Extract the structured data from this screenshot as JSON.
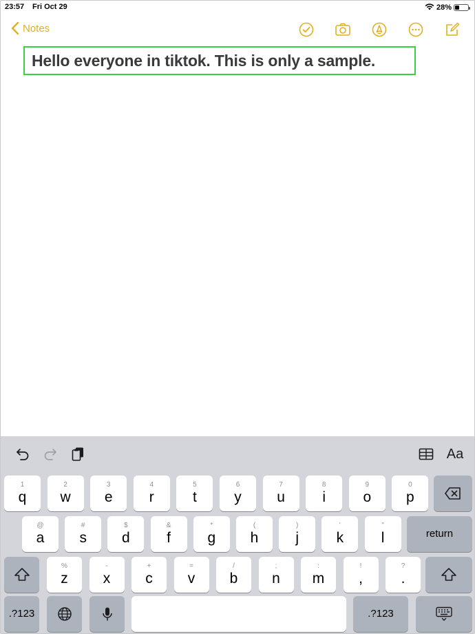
{
  "status_bar": {
    "time": "23:57",
    "date": "Fri Oct 29",
    "battery_text": "28%",
    "battery_level": 0.28
  },
  "nav": {
    "back_label": "Notes",
    "icons": [
      "checklist-icon",
      "camera-icon",
      "markup-icon",
      "more-icon",
      "compose-icon"
    ],
    "accent_color": "#e0b020"
  },
  "note": {
    "text": "Hello everyone in tiktok. This is only a sample.",
    "highlight_color": "#3bd146"
  },
  "keyboard": {
    "toolbar": {
      "format_label": "Aa"
    },
    "row1": [
      {
        "sub": "1",
        "main": "q"
      },
      {
        "sub": "2",
        "main": "w"
      },
      {
        "sub": "3",
        "main": "e"
      },
      {
        "sub": "4",
        "main": "r"
      },
      {
        "sub": "5",
        "main": "t"
      },
      {
        "sub": "6",
        "main": "y"
      },
      {
        "sub": "7",
        "main": "u"
      },
      {
        "sub": "8",
        "main": "i"
      },
      {
        "sub": "9",
        "main": "o"
      },
      {
        "sub": "0",
        "main": "p"
      }
    ],
    "row2": [
      {
        "sub": "@",
        "main": "a"
      },
      {
        "sub": "#",
        "main": "s"
      },
      {
        "sub": "$",
        "main": "d"
      },
      {
        "sub": "&",
        "main": "f"
      },
      {
        "sub": "*",
        "main": "g"
      },
      {
        "sub": "(",
        "main": "h"
      },
      {
        "sub": ")",
        "main": "j"
      },
      {
        "sub": "'",
        "main": "k"
      },
      {
        "sub": "\"",
        "main": "l"
      }
    ],
    "row3": [
      {
        "sub": "%",
        "main": "z"
      },
      {
        "sub": "-",
        "main": "x"
      },
      {
        "sub": "+",
        "main": "c"
      },
      {
        "sub": "=",
        "main": "v"
      },
      {
        "sub": "/",
        "main": "b"
      },
      {
        "sub": ";",
        "main": "n"
      },
      {
        "sub": ":",
        "main": "m"
      },
      {
        "sub": "!",
        "main": ","
      },
      {
        "sub": "?",
        "main": "."
      }
    ],
    "return_label": "return",
    "numbers_label": ".?123"
  }
}
